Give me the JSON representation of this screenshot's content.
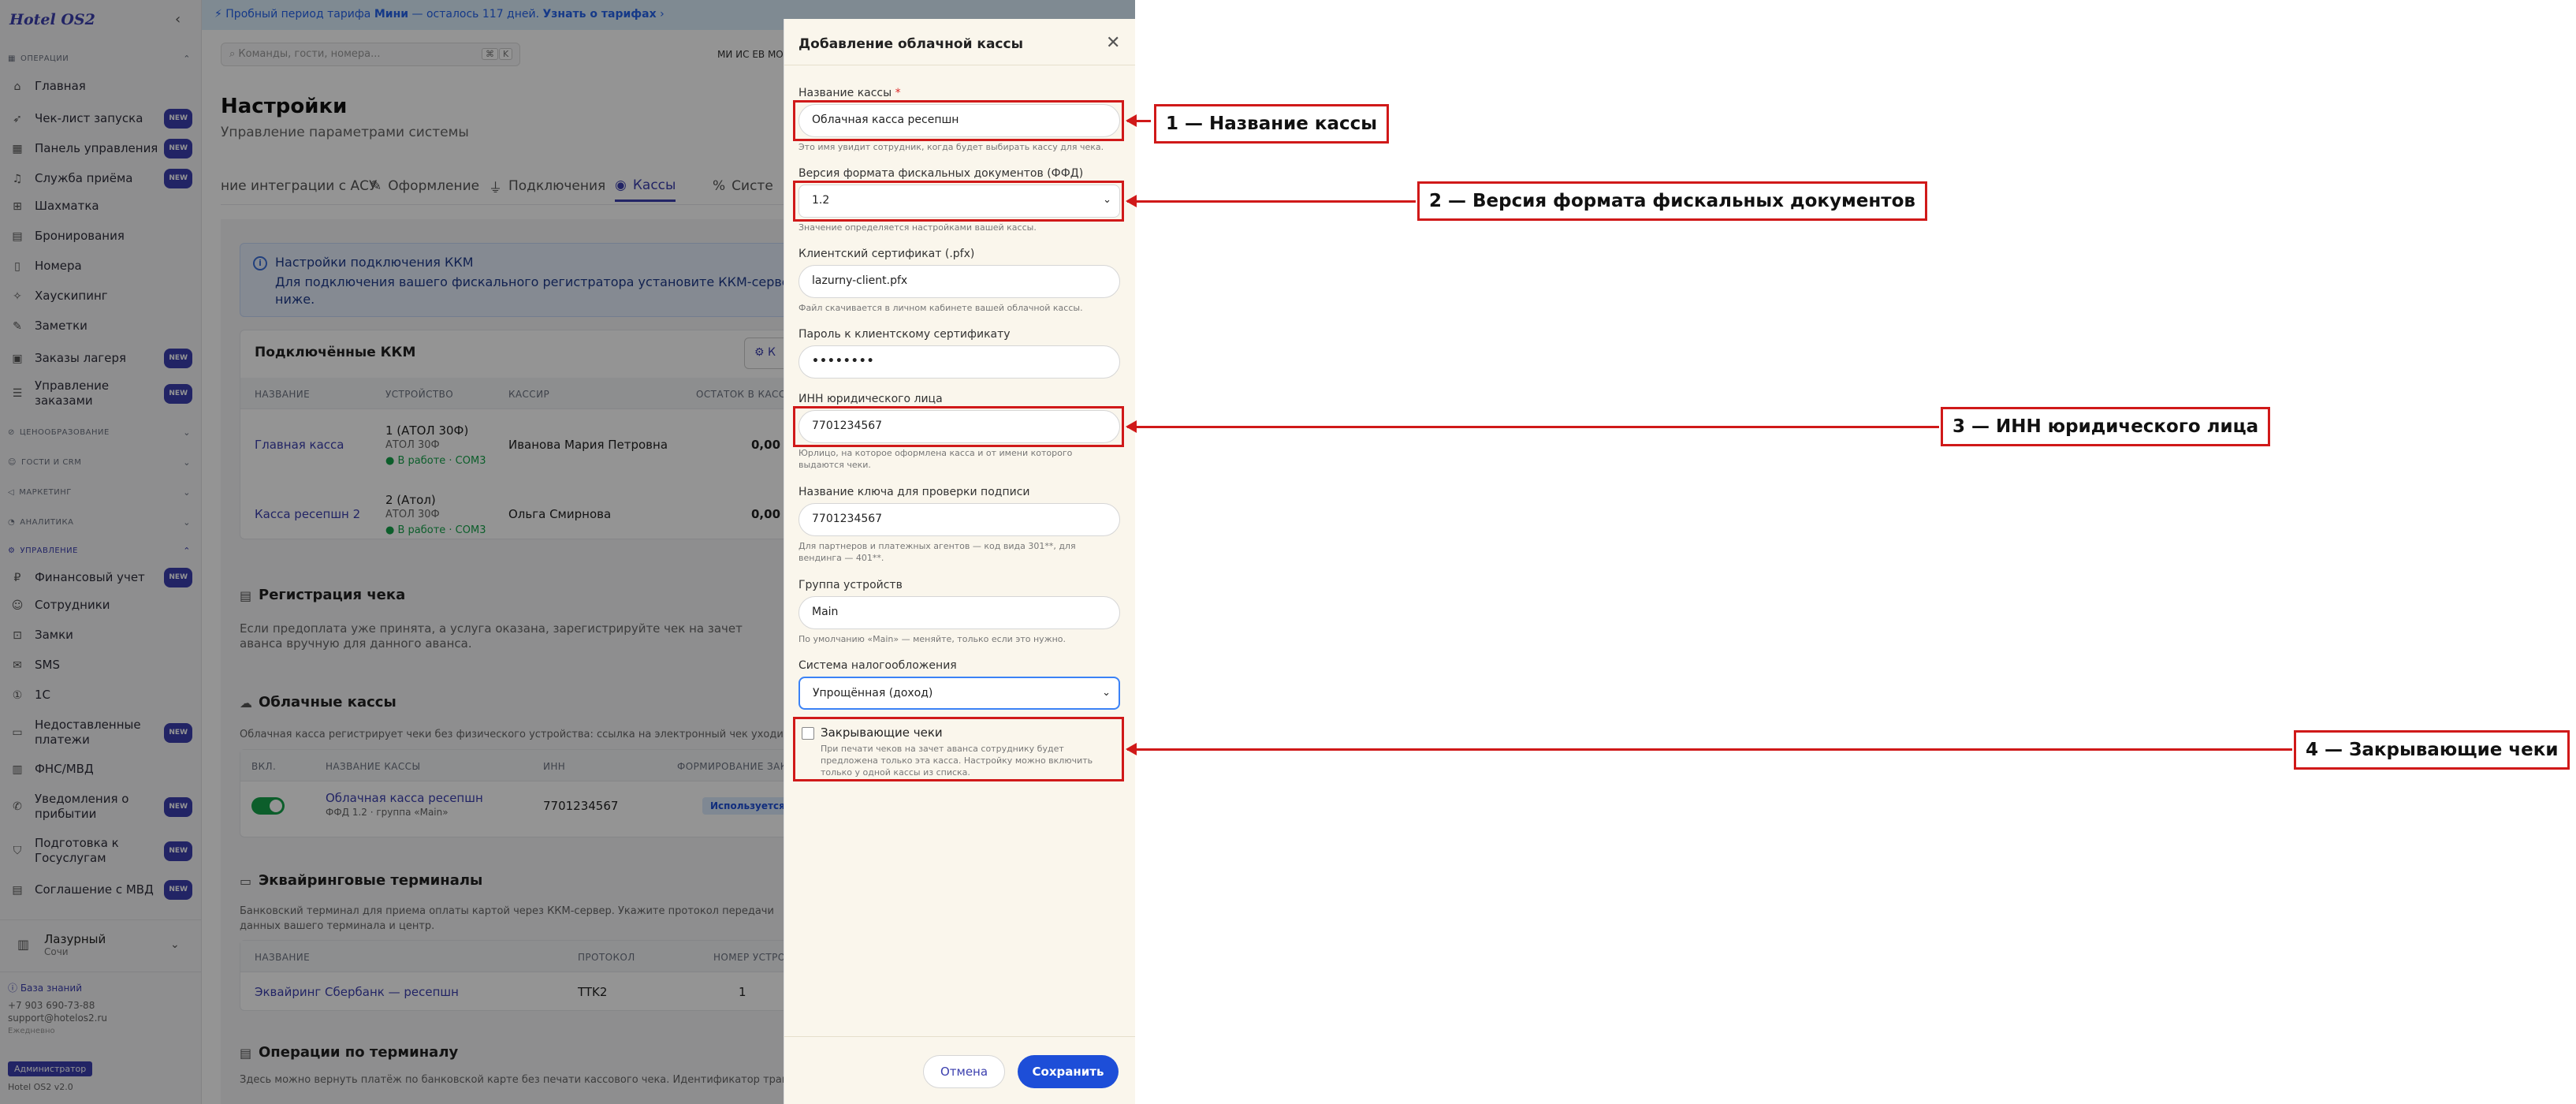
{
  "app": {
    "logo": "Hotel OS2"
  },
  "banner": {
    "prefix": "Пробный период тарифа",
    "plan": "Мини",
    "rest": "— осталось 117 дней.",
    "link": "Узнать о тарифах"
  },
  "search": {
    "placeholder": "Команды, гости, номера...",
    "kbd1": "⌘",
    "kbd2": "K",
    "user": "МИ ИС ЕВ МОЗ"
  },
  "sidebar": {
    "sec_ops": "ОПЕРАЦИИ",
    "items": [
      {
        "label": "Главная",
        "icon": "home-icon",
        "glyph": "⌂"
      },
      {
        "label": "Чек-лист запуска",
        "icon": "rocket-icon",
        "glyph": "➶",
        "badge": "NEW"
      },
      {
        "label": "Панель управления",
        "icon": "dashboard-icon",
        "glyph": "▦",
        "badge": "NEW"
      },
      {
        "label": "Служба приёма",
        "icon": "bell-icon",
        "glyph": "♫",
        "badge": "NEW"
      },
      {
        "label": "Шахматка",
        "icon": "grid-icon",
        "glyph": "⊞"
      },
      {
        "label": "Бронирования",
        "icon": "calendar-icon",
        "glyph": "▤"
      },
      {
        "label": "Номера",
        "icon": "door-icon",
        "glyph": "▯"
      },
      {
        "label": "Хаускипинг",
        "icon": "broom-icon",
        "glyph": "✧"
      },
      {
        "label": "Заметки",
        "icon": "note-icon",
        "glyph": "✎"
      },
      {
        "label": "Заказы лагеря",
        "icon": "bag-icon",
        "glyph": "▣",
        "badge": "NEW"
      },
      {
        "label": "Управление",
        "label2": "заказами",
        "icon": "list-icon",
        "glyph": "☰",
        "badge": "NEW"
      }
    ],
    "sec_pricing": "ЦЕНООБРАЗОВАНИЕ",
    "sec_guests": "ГОСТИ И CRM",
    "sec_marketing": "МАРКЕТИНГ",
    "sec_analytics": "АНАЛИТИКА",
    "sec_manage": "УПРАВЛЕНИЕ",
    "manage_items": [
      {
        "label": "Финансовый учет",
        "icon": "finance-icon",
        "glyph": "₽",
        "badge": "NEW"
      },
      {
        "label": "Сотрудники",
        "icon": "users-icon",
        "glyph": "☺"
      },
      {
        "label": "Замки",
        "icon": "lock-icon",
        "glyph": "⊡"
      },
      {
        "label": "SMS",
        "icon": "sms-icon",
        "glyph": "✉"
      },
      {
        "label": "1С",
        "icon": "onec-icon",
        "glyph": "①"
      },
      {
        "label": "Недоставленные",
        "label2": "платежи",
        "icon": "payment-icon",
        "glyph": "▭",
        "badge": "NEW"
      },
      {
        "label": "ФНС/МВД",
        "icon": "building-icon",
        "glyph": "▥"
      },
      {
        "label": "Уведомления о",
        "label2": "прибытии",
        "icon": "notify-icon",
        "glyph": "✆",
        "badge": "NEW"
      },
      {
        "label": "Подготовка к",
        "label2": "Госуслугам",
        "icon": "shield-icon",
        "glyph": "⛉",
        "badge": "NEW"
      },
      {
        "label": "Соглашение с МВД",
        "icon": "doc-icon",
        "glyph": "▤",
        "badge": "NEW"
      }
    ],
    "hotel_name": "Лазурный",
    "hotel_city": "Сочи",
    "kb_link": "База знаний",
    "phone": "+7 903 690-73-88",
    "email": "support@hotelos2.ru",
    "footer_note": "Ежедневно",
    "role": "Администратор",
    "version": "Hotel OS2 v2.0"
  },
  "page": {
    "title": "Настройки",
    "subtitle": "Управление параметрами системы",
    "tabs": [
      "ние интеграции с АСУ",
      "Оформление",
      "Подключения",
      "Кассы",
      "Систе"
    ],
    "info_title": "Настройки подключения ККМ",
    "info_text": "Для подключения вашего фискального регистратора установите ККМ-сервер на компьютер и укажите параметры ниже.",
    "kkm_title": "Подключённые ККМ",
    "kkm_headers": [
      "НАЗВАНИЕ",
      "УСТРОЙСТВО",
      "КАССИР",
      "ОСТАТОК В КАССЕ"
    ],
    "kkm_rows": [
      {
        "name": "Главная касса",
        "device": "1 (АТОЛ 30Ф)",
        "model": "АТОЛ 30Ф",
        "status": "● В работе · COM3",
        "cashier": "Иванова Мария Петровна",
        "balance": "0,00 ₽"
      },
      {
        "name": "Касса ресепшн 2",
        "device": "2 (Атол)",
        "model": "АТОЛ 30Ф",
        "status": "● В работе · COM3",
        "cashier": "Ольга Смирнова",
        "balance": "0,00 ₽"
      }
    ],
    "reg_title": "Регистрация чека",
    "reg_text": "Если предоплата уже принята, а услуга оказана, зарегистрируйте чек на зачет аванса вручную для данного аванса.",
    "cloud_title": "Облачные кассы",
    "cloud_text": "Облачная касса регистрирует чеки без физического устройства: ссылка на электронный чек уходит плательщику.",
    "cloud_headers": [
      "ВКЛ.",
      "НАЗВАНИЕ КАССЫ",
      "ИНН",
      "ФОРМИРОВАНИЕ ЗАКРЫ"
    ],
    "cloud_row": {
      "name": "Облачная касса ресепшн",
      "sub": "ФФД 1.2 · группа «Main»",
      "inn": "7701234567",
      "status": "Используется"
    },
    "acq_title": "Эквайринговые терминалы",
    "acq_text": "Банковский терминал для приема оплаты картой через ККМ-сервер. Укажите протокол передачи данных вашего терминала и центр.",
    "acq_headers": [
      "НАЗВАНИЕ",
      "ПРОТОКОЛ",
      "НОМЕР УСТРОЙ"
    ],
    "acq_row": {
      "name": "Эквайринг Сбербанк — ресепшн",
      "protocol": "TTK2",
      "num": "1"
    },
    "ops_title": "Операции по терминалу",
    "ops_text": "Здесь можно вернуть платёж по банковской карте без печати кассового чека. Идентификатор транзакции есть в"
  },
  "modal": {
    "title": "Добавление облачной кассы",
    "f1_label": "Название кассы",
    "f1_req": "*",
    "f1_value": "Облачная касса ресепшн",
    "f1_hint": "Это имя увидит сотрудник, когда будет выбирать кассу для чека.",
    "f2_label": "Версия формата фискальных документов (ФФД)",
    "f2_value": "1.2",
    "f2_hint": "Значение определяется настройками вашей кассы.",
    "f3_label": "Клиентский сертификат (.pfx)",
    "f3_value": "lazurny-client.pfx",
    "f3_hint": "Файл скачивается в личном кабинете вашей облачной кассы.",
    "f4_label": "Пароль к клиентскому сертификату",
    "f4_value": "••••••••",
    "f5_label": "ИНН юридического лица",
    "f5_value": "7701234567",
    "f5_hint": "Юрлицо, на которое оформлена касса и от имени которого выдаются чеки.",
    "f6_label": "Название ключа для проверки подписи",
    "f6_value": "7701234567",
    "f6_hint": "Для партнеров и платежных агентов — код вида 301**, для вендинга — 401**.",
    "f7_label": "Группа устройств",
    "f7_value": "Main",
    "f7_hint": "По умолчанию «Main» — меняйте, только если это нужно.",
    "f8_label": "Система налогообложения",
    "f8_value": "Упрощённая (доход)",
    "cb_label": "Закрывающие чеки",
    "cb_hint": "При печати чеков на зачет аванса сотруднику будет предложена только эта касса. Настройку можно включить только у одной кассы из списка.",
    "cancel": "Отмена",
    "save": "Сохранить"
  },
  "callouts": [
    "1 — Название кассы",
    "2 — Версия формата фискальных документов",
    "3 — ИНН юридического лица",
    "4 — Закрывающие чеки"
  ],
  "colors": {
    "accent": "#3b3fae",
    "highlight": "#d01919",
    "save": "#1d4ed8"
  }
}
